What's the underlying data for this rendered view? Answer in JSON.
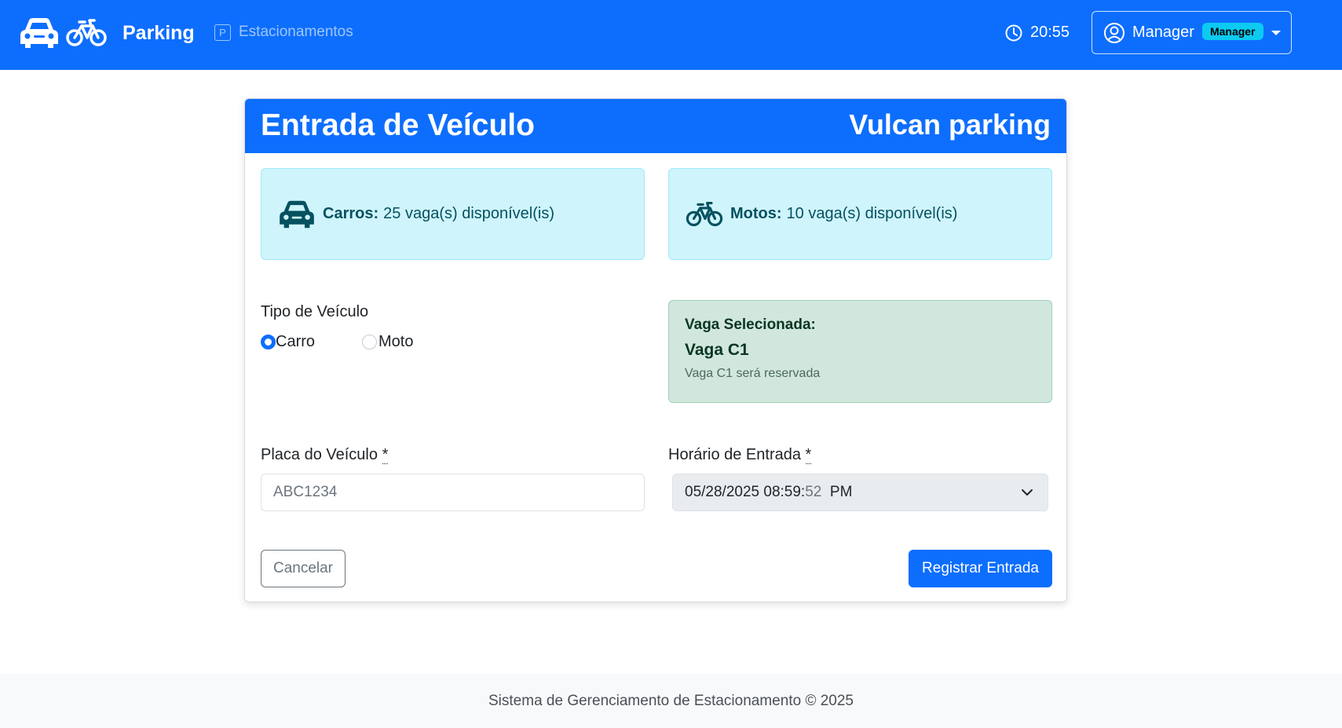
{
  "navbar": {
    "brand": "Parking",
    "link_parkings": "Estacionamentos",
    "parking_icon_glyph": "P",
    "time": "20:55",
    "user_name": "Manager",
    "user_role": "Manager",
    "colors": {
      "primary": "#0d6efd",
      "badge": "#0dcaf0"
    }
  },
  "card": {
    "title": "Entrada de Veículo",
    "parking_name": "Vulcan parking",
    "cars": {
      "label": "Carros:",
      "text": "25 vaga(s) disponível(is)"
    },
    "motos": {
      "label": "Motos:",
      "text": "10 vaga(s) disponível(is)"
    },
    "vehicle_type_label": "Tipo de Veículo",
    "vehicle_types": [
      {
        "label": "Carro",
        "checked": true
      },
      {
        "label": "Moto",
        "checked": false
      }
    ],
    "selected_spot": {
      "heading": "Vaga Selecionada:",
      "spot": "Vaga C1",
      "note": "Vaga C1 será reservada"
    },
    "plate": {
      "label": "Placa do Veículo",
      "required_mark": "*",
      "placeholder": "ABC1234"
    },
    "entry_time": {
      "label": "Horário de Entrada",
      "required_mark": "*",
      "value_main": "05/28/2025 08:59:",
      "value_seconds": "52",
      "value_ampm": "PM"
    },
    "cancel_label": "Cancelar",
    "submit_label": "Registrar Entrada"
  },
  "footer": {
    "text": "Sistema de Gerenciamento de Estacionamento © 2025"
  }
}
